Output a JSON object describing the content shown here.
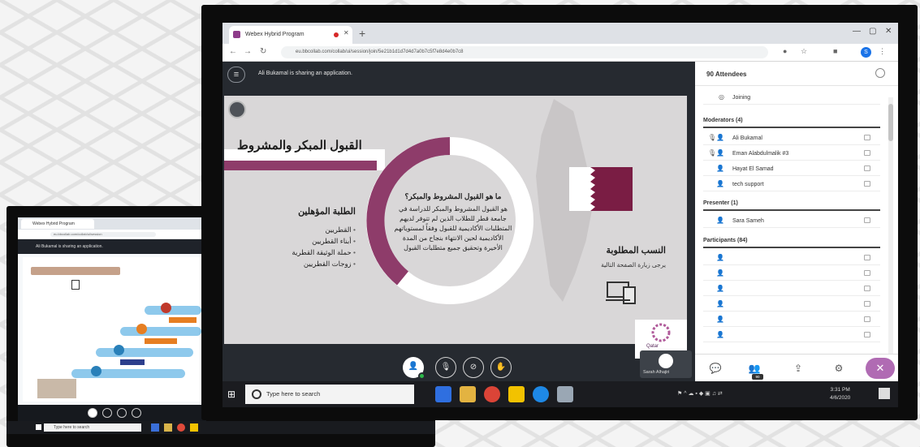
{
  "back_screen": {
    "tab_title": "Webex Hybrid Program",
    "url": "eu.bbcollab.com/collab/ui/session",
    "sharing_text": "Ali Bukamal is sharing an application.",
    "search_placeholder": "Type here to search"
  },
  "front_screen": {
    "tab_title": "Webex Hybrid Program",
    "url": "eu.bbcollab.com/collab/ui/session/join/5e21b1d1d7d4d7a0b7c5f7e8d4e0b7c8",
    "sharing_text": "Ali Bukamal is sharing an application.",
    "profile_initial": "S",
    "slide": {
      "banner_title": "القبول المبكر والمشروط",
      "question_title": "ما هو القبول المشروط والمبكر؟",
      "question_body": "هو القبول المشروط والمبكر للدراسة في جامعة قطر للطلاب الذين لم تتوفر لديهم المتطلبات الأكاديمية للقبول وفقاً لمستوياتهم الأكاديمية لحين الانتهاء بنجاح من المدة الأخيرة وتحقيق جميع متطلبات القبول",
      "left_title": "الطلبة المؤهلين",
      "left_items": [
        "القطريين",
        "أبناء القطريين",
        "حملة الوثيقة القطرية",
        "زوجات القطريين"
      ],
      "right_title": "النسب المطلوبة",
      "right_sub": "يرجى زيارة الصفحة التالية",
      "brand_word": "Qatar"
    },
    "controls": {
      "camera_thumb_name": "Sarah Alhajiri"
    },
    "panel": {
      "header": "90 Attendees",
      "joining": "Joining",
      "moderators_header": "Moderators (4)",
      "moderators": [
        "Ali Bukamal",
        "Eman Alabdulmalik #3",
        "Hayat El Samad",
        "tech support"
      ],
      "presenter_header": "Presenter (1)",
      "presenter": "Sara Sameh",
      "participants_header": "Participants (84)",
      "participant_count_rows": 6,
      "badge": "90"
    },
    "taskbar": {
      "search_placeholder": "Type here to search",
      "time": "3:31 PM",
      "date": "4/6/2020"
    }
  },
  "colors": {
    "accent_purple": "#8e3c6a",
    "collab_purple": "#b06bb3",
    "presence_green": "#2db84a",
    "blue_step": "#8ec9ec"
  }
}
